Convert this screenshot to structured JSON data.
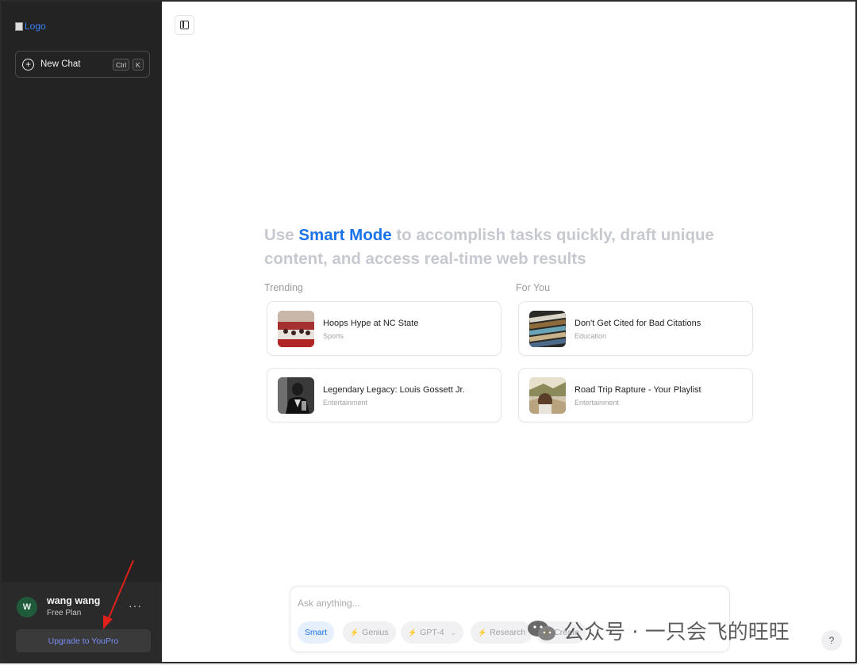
{
  "sidebar": {
    "logo_alt": "Logo",
    "new_chat_label": "New Chat",
    "shortcut_keys": [
      "Ctrl",
      "K"
    ],
    "user": {
      "initial": "W",
      "name": "wang wang",
      "plan": "Free Plan"
    },
    "more_label": "···",
    "upgrade_label": "Upgrade to YouPro"
  },
  "main": {
    "headline_prefix": "Use ",
    "headline_accent": "Smart Mode",
    "headline_rest": " to accomplish tasks quickly, draft unique content, and access real-time web results",
    "sections": [
      {
        "label": "Trending",
        "cards": [
          {
            "title": "Hoops Hype at NC State",
            "category": "Sports"
          },
          {
            "title": "Legendary Legacy: Louis Gossett Jr.",
            "category": "Entertainment"
          }
        ]
      },
      {
        "label": "For You",
        "cards": [
          {
            "title": "Don't Get Cited for Bad Citations",
            "category": "Education"
          },
          {
            "title": "Road Trip Rapture - Your Playlist",
            "category": "Entertainment"
          }
        ]
      }
    ]
  },
  "composer": {
    "placeholder": "Ask anything...",
    "modes": [
      {
        "label": "Smart",
        "active": true
      },
      {
        "label": "Genius",
        "active": false
      },
      {
        "label": "GPT-4",
        "active": false
      },
      {
        "label": "Research",
        "active": false
      },
      {
        "label": "Create",
        "active": false
      }
    ]
  },
  "help_label": "?",
  "watermark": "公众号 · 一只会飞的旺旺",
  "colors": {
    "accent": "#1a73e8",
    "sidebar_bg": "#232323",
    "upgrade_text": "#7b8ff5",
    "arrow": "#e0201a"
  }
}
